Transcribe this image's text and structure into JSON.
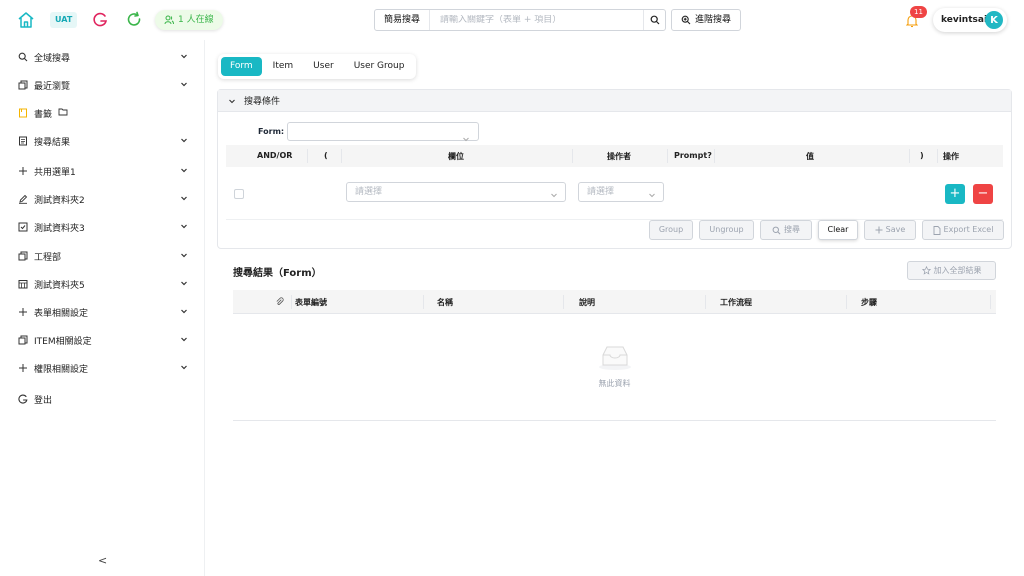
{
  "header": {
    "env_badge": "UAT",
    "online_status": "1 人在線",
    "search_mode": "簡易搜尋",
    "search_placeholder": "請輸入關鍵字（表單 + 項目）",
    "advanced_search": "進階搜尋",
    "notification_count": "11",
    "username": "kevintsai",
    "avatar_initial": "K"
  },
  "sidebar": {
    "items": [
      {
        "label": "全域搜尋",
        "icon": "search-icon"
      },
      {
        "label": "最近瀏覽",
        "icon": "copy-icon"
      },
      {
        "label": "書籤",
        "icon": "bookmark-icon"
      },
      {
        "label": "搜尋結果",
        "icon": "list-icon"
      },
      {
        "label": "共用選單1",
        "icon": "plus-icon"
      },
      {
        "label": "測試資料夾2",
        "icon": "edit-icon"
      },
      {
        "label": "測試資料夾3",
        "icon": "checkbox-icon"
      },
      {
        "label": "工程部",
        "icon": "copy-icon"
      },
      {
        "label": "測試資料夾5",
        "icon": "calendar-icon"
      },
      {
        "label": "表單相關設定",
        "icon": "plus-icon"
      },
      {
        "label": "ITEM相關設定",
        "icon": "copy-icon"
      },
      {
        "label": "權限相關設定",
        "icon": "plus-icon"
      },
      {
        "label": "登出",
        "icon": "logout-icon"
      }
    ],
    "collapse_glyph": "<"
  },
  "tabs": [
    "Form",
    "Item",
    "User",
    "User Group"
  ],
  "criteria": {
    "title": "搜尋條件",
    "form_label": "Form:",
    "columns": {
      "andor": "AND/OR",
      "lparen": "(",
      "field": "欄位",
      "operator": "操作者",
      "prompt": "Prompt?",
      "value": "值",
      "rparen": ")",
      "action": "操作"
    },
    "field_placeholder": "請選擇",
    "operator_placeholder": "請選擇",
    "buttons": {
      "group": "Group",
      "ungroup": "Ungroup",
      "search": "搜尋",
      "clear": "Clear",
      "save": "Save",
      "export": "Export Excel"
    }
  },
  "results": {
    "title": "搜尋結果（Form）",
    "add_all": "加入全部結果",
    "columns": [
      "表單編號",
      "名稱",
      "說明",
      "工作流程",
      "步驟"
    ],
    "empty_text": "無此資料"
  },
  "colors": {
    "accent": "#19b8c4",
    "danger": "#ef4444",
    "online": "#3ab54a"
  }
}
